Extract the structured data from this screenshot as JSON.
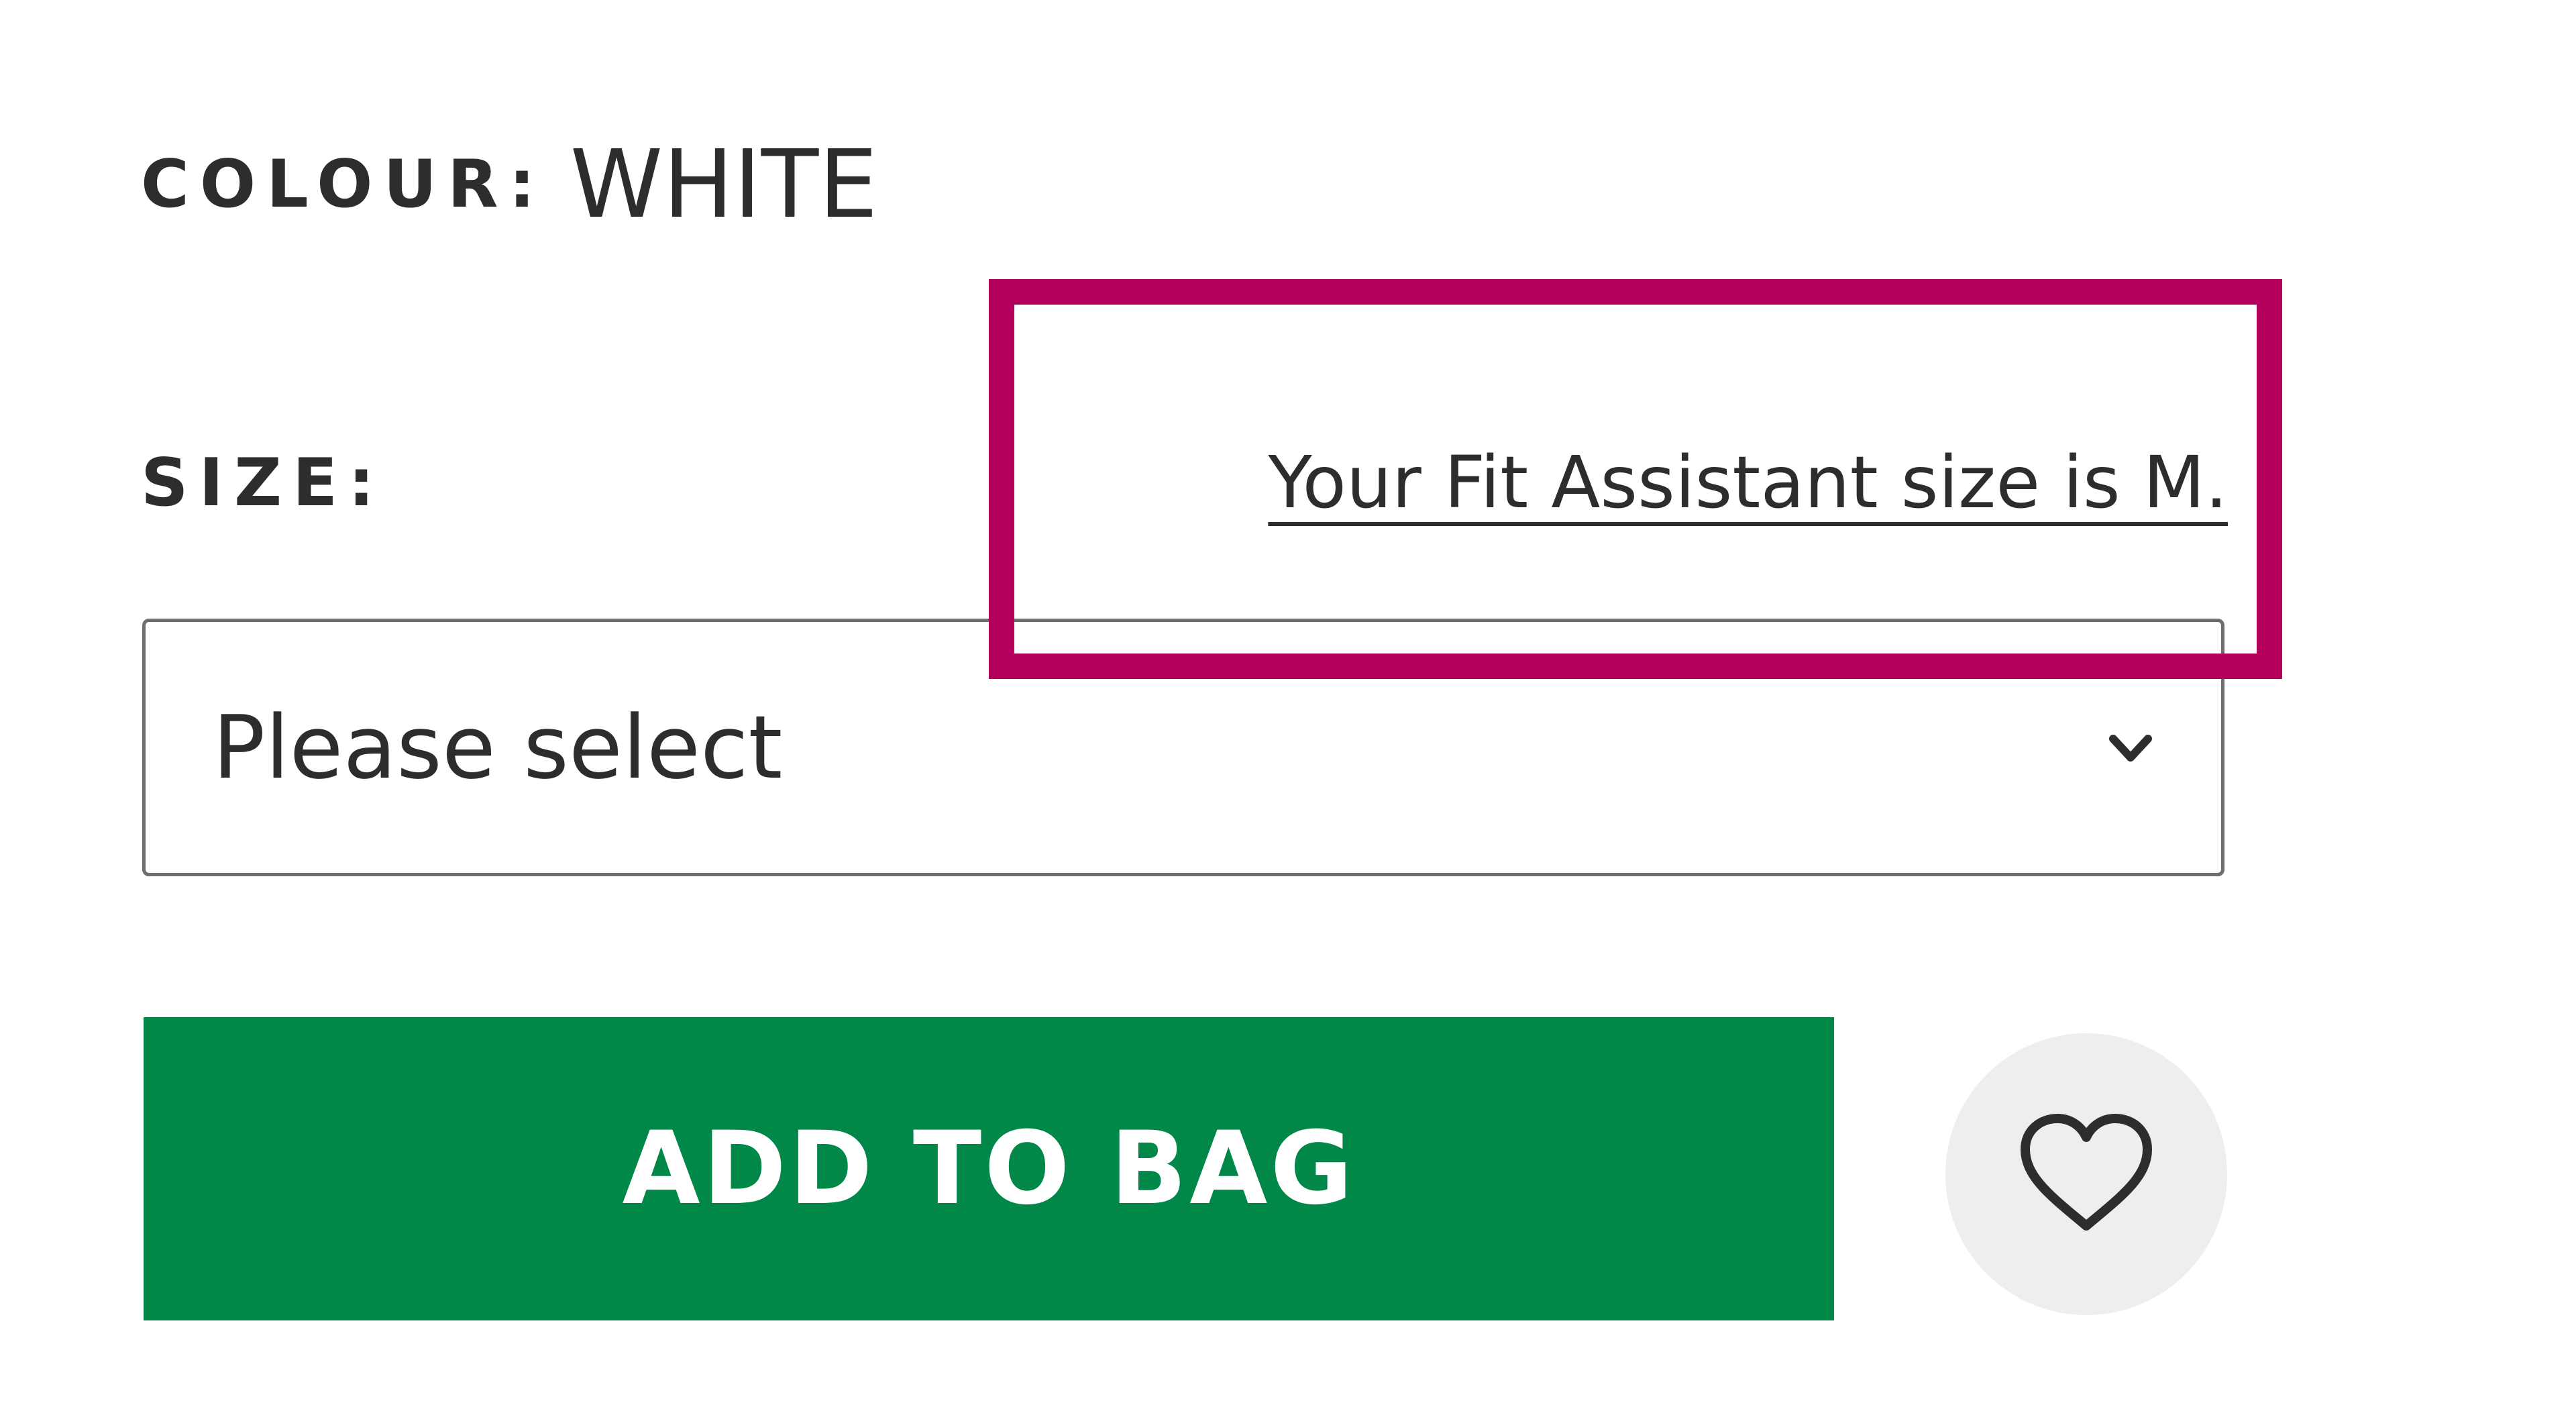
{
  "colour": {
    "label": "COLOUR:",
    "value": "WHITE"
  },
  "size": {
    "label": "SIZE:",
    "fit_assistant_link": "Your Fit Assistant size is M.",
    "select": {
      "selected_value": "Please select",
      "icon": "chevron-down-icon"
    }
  },
  "actions": {
    "add_to_bag_label": "ADD TO BAG",
    "wishlist_icon": "heart-icon"
  },
  "colors": {
    "add_to_bag": "#018849",
    "highlight": "#b4005a",
    "wishlist_bg": "#eeeeee",
    "text": "#2d2d2d"
  }
}
